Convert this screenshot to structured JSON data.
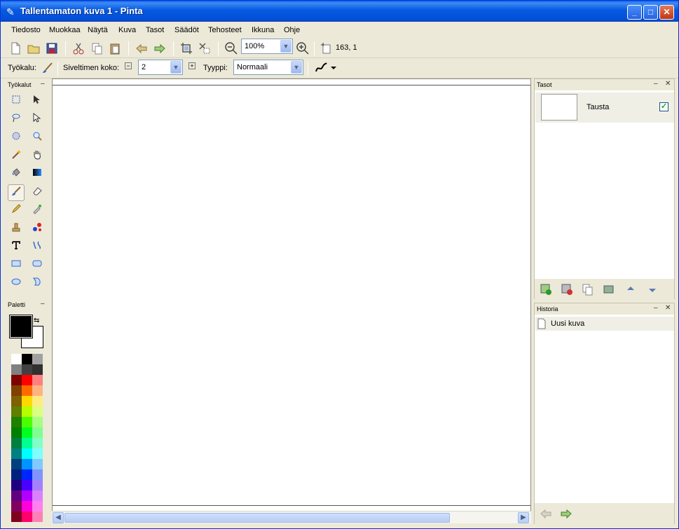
{
  "window": {
    "title": "Tallentamaton kuva 1 - Pinta",
    "minimize": "_",
    "maximize": "□",
    "close": "✕"
  },
  "menu": [
    "Tiedosto",
    "Muokkaa",
    "Näytä",
    "Kuva",
    "Tasot",
    "Säädöt",
    "Tehosteet",
    "Ikkuna",
    "Ohje"
  ],
  "toolbar": {
    "zoom_value": "100%",
    "cursor_position": "163, 1"
  },
  "toolbar2": {
    "tool_label": "Työkalu:",
    "brush_size_label": "Siveltimen koko:",
    "brush_size_value": "2",
    "type_label": "Tyyppi:",
    "type_value": "Normaali",
    "minus": "−",
    "plus": "+"
  },
  "tools_panel": {
    "title": "Työkalut",
    "collapse": "–"
  },
  "palette_panel": {
    "title": "Paletti",
    "collapse": "–"
  },
  "layers_panel": {
    "title": "Tasot",
    "collapse": "–",
    "close": "✕",
    "layer_name": "Tausta",
    "checked": "✓"
  },
  "history_panel": {
    "title": "Historia",
    "collapse": "–",
    "close": "✕",
    "item": "Uusi kuva"
  },
  "colors": {
    "primary": "#000000",
    "secondary": "#ffffff",
    "swatches": [
      [
        "#ffffff",
        "#000000",
        "#a0a0a0"
      ],
      [
        "#808080",
        "#404040",
        "#303030"
      ],
      [
        "#800000",
        "#ff0000",
        "#ff8080"
      ],
      [
        "#804000",
        "#ff6a00",
        "#ffb380"
      ],
      [
        "#806000",
        "#ffd800",
        "#ffec80"
      ],
      [
        "#608000",
        "#b6ff00",
        "#dbff80"
      ],
      [
        "#208000",
        "#4cff00",
        "#a5ff80"
      ],
      [
        "#008000",
        "#00ff21",
        "#80ff90"
      ],
      [
        "#008040",
        "#00ff90",
        "#80ffc8"
      ],
      [
        "#008080",
        "#00ffff",
        "#80ffff"
      ],
      [
        "#004080",
        "#0094ff",
        "#80caff"
      ],
      [
        "#002080",
        "#0026ff",
        "#8093ff"
      ],
      [
        "#200080",
        "#4800ff",
        "#a480ff"
      ],
      [
        "#600080",
        "#b200ff",
        "#d980ff"
      ],
      [
        "#800060",
        "#ff00dc",
        "#ff80ee"
      ],
      [
        "#800020",
        "#ff006e",
        "#ff80b6"
      ]
    ]
  }
}
